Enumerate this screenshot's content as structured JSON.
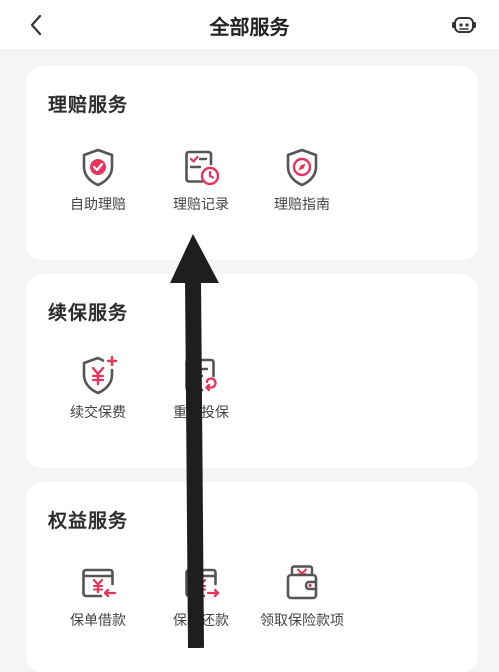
{
  "header": {
    "title": "全部服务",
    "back_icon": "chevron-left-icon",
    "service_icon": "robot-assistant-icon"
  },
  "colors": {
    "accent": "#e8345a",
    "icon_gray": "#555555",
    "arrow": "#1e1e1e"
  },
  "sections": [
    {
      "title": "理赔服务",
      "items": [
        {
          "label": "自助理赔",
          "icon": "shield-check-icon"
        },
        {
          "label": "理赔记录",
          "icon": "checklist-clock-icon"
        },
        {
          "label": "理赔指南",
          "icon": "shield-compass-icon"
        }
      ]
    },
    {
      "title": "续保服务",
      "items": [
        {
          "label": "续交保费",
          "icon": "shield-yuan-plus-icon"
        },
        {
          "label": "重新投保",
          "icon": "document-refresh-icon"
        }
      ]
    },
    {
      "title": "权益服务",
      "items": [
        {
          "label": "保单借款",
          "icon": "card-yuan-in-icon"
        },
        {
          "label": "保单还款",
          "icon": "card-yuan-out-icon"
        },
        {
          "label": "领取保险款项",
          "icon": "wallet-yuan-icon"
        }
      ]
    }
  ]
}
